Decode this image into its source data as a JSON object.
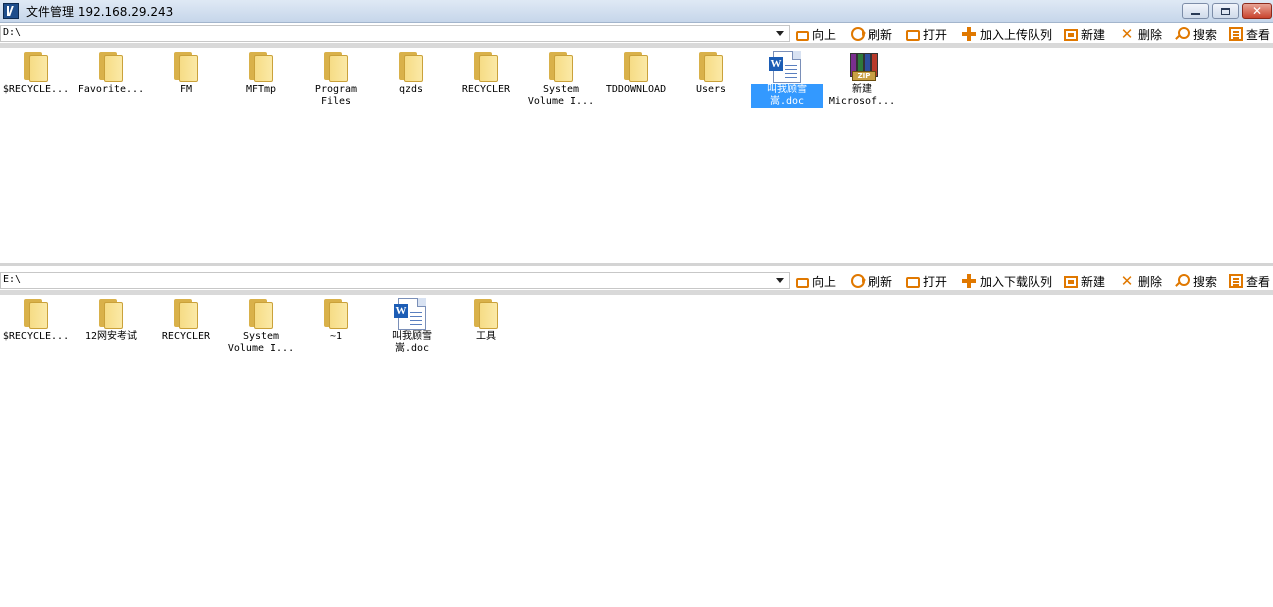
{
  "window": {
    "title": "文件管理 192.168.29.243",
    "minimize_icon": "minimize-icon",
    "maximize_icon": "restore-icon",
    "close_icon": "close-icon"
  },
  "top_pane": {
    "path": "D:\\",
    "toolbar": {
      "up_label": "向上",
      "refresh_label": "刷新",
      "open_label": "打开",
      "queue_label": "加入上传队列",
      "new_label": "新建",
      "delete_label": "删除",
      "search_label": "搜索",
      "view_label": "查看"
    },
    "items": [
      {
        "name": "$RECYCLE...",
        "type": "folder"
      },
      {
        "name": "Favorite...",
        "type": "folder"
      },
      {
        "name": "FM",
        "type": "folder"
      },
      {
        "name": "MFTmp",
        "type": "folder"
      },
      {
        "name": "Program Files",
        "type": "folder"
      },
      {
        "name": "qzds",
        "type": "folder"
      },
      {
        "name": "RECYCLER",
        "type": "folder"
      },
      {
        "name": "System Volume I...",
        "type": "folder"
      },
      {
        "name": "TDDOWNLOAD",
        "type": "folder"
      },
      {
        "name": "Users",
        "type": "folder"
      },
      {
        "name": "叫我顾雪嵩.doc",
        "type": "word-doc",
        "selected": true
      },
      {
        "name": "新建 Microsof...",
        "type": "zip-archive"
      }
    ]
  },
  "bottom_pane": {
    "path": "E:\\",
    "toolbar": {
      "up_label": "向上",
      "refresh_label": "刷新",
      "open_label": "打开",
      "queue_label": "加入下载队列",
      "new_label": "新建",
      "delete_label": "删除",
      "search_label": "搜索",
      "view_label": "查看"
    },
    "items": [
      {
        "name": "$RECYCLE...",
        "type": "folder"
      },
      {
        "name": "12网安考试",
        "type": "folder"
      },
      {
        "name": "RECYCLER",
        "type": "folder"
      },
      {
        "name": "System Volume I...",
        "type": "folder"
      },
      {
        "name": "~1",
        "type": "folder"
      },
      {
        "name": "叫我顾雪嵩.doc",
        "type": "word-doc"
      },
      {
        "name": "工具",
        "type": "folder"
      }
    ]
  },
  "colors": {
    "toolbar_icon": "#e07800",
    "selection": "#3399ff",
    "folder": "#f6dc86"
  }
}
